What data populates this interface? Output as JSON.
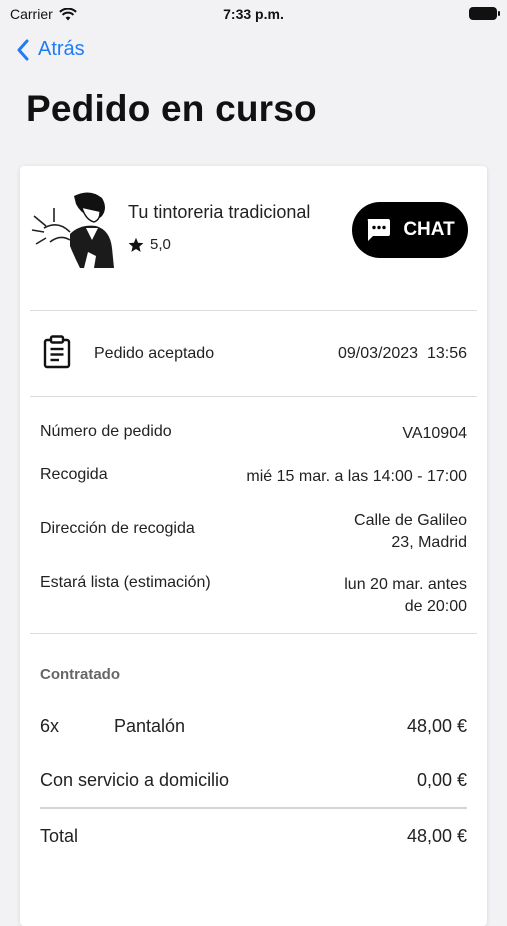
{
  "status_bar": {
    "carrier": "Carrier",
    "time": "7:33 p.m."
  },
  "nav": {
    "back_label": "Atrás"
  },
  "page": {
    "title": "Pedido en curso"
  },
  "shop": {
    "name": "Tu tintoreria tradicional",
    "rating": "5,0",
    "chat_label": "CHAT"
  },
  "order_status": {
    "label": "Pedido aceptado",
    "date": "09/03/2023  13:56"
  },
  "info": {
    "order_number_label": "Número de pedido",
    "order_number": "VA10904",
    "pickup_label": "Recogida",
    "pickup_value": "mié 15 mar. a las 14:00 - 17:00",
    "address_label": "Dirección de recogida",
    "address_line1": "Calle de Galileo",
    "address_line2": "23, Madrid",
    "ready_label": "Estará lista (estimación)",
    "ready_line1": "lun 20 mar. antes",
    "ready_line2": "de 20:00"
  },
  "contracted": {
    "title": "Contratado",
    "item": {
      "qty": "6x",
      "name": "Pantalón",
      "price": "48,00 €"
    },
    "service_label": "Con servicio a domicilio",
    "service_price": "0,00 €",
    "total_label": "Total",
    "total_price": "48,00 €"
  },
  "colors": {
    "accent": "#1f7cf3",
    "button": "#000000"
  }
}
